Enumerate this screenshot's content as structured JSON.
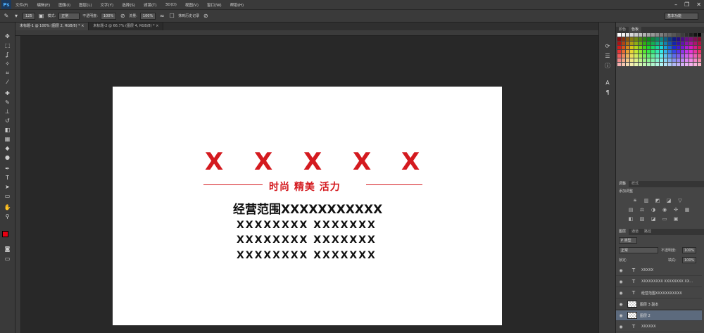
{
  "app": {
    "logo": "Ps"
  },
  "menu": [
    "文件(F)",
    "编辑(E)",
    "图像(I)",
    "图层(L)",
    "文字(Y)",
    "选择(S)",
    "滤镜(T)",
    "3D(D)",
    "视图(V)",
    "窗口(W)",
    "帮助(H)"
  ],
  "window_controls": {
    "minimize": "–",
    "restore": "❐",
    "close": "✕"
  },
  "options": {
    "brush_size": "125",
    "mode_label": "模式:",
    "mode_value": "正常",
    "opacity_label": "不透明度:",
    "opacity_value": "100%",
    "flow_label": "流量:",
    "flow_value": "100%",
    "history_label": "抹到历史记录",
    "workspace": "基本功能"
  },
  "tabs": [
    {
      "label": "未标题-1 @ 100% (图层 2, RGB/8) *  ×",
      "active": true
    },
    {
      "label": "未标题-2 @ 66.7% (图层 4, RGB/8) *  ×",
      "active": false
    }
  ],
  "canvas": {
    "x_marks": [
      "X",
      "X",
      "X",
      "X",
      "X"
    ],
    "tagline": "时尚 精美 活力",
    "scope": "经营范围XXXXXXXXXXX",
    "lines": [
      "XXXXXXXX XXXXXXX",
      "XXXXXXXX XXXXXXX",
      "XXXXXXXX XXXXXXX"
    ]
  },
  "colors": {
    "accent_red": "#d41a1f",
    "fg_color": "#e60012",
    "bg_color": "#ffffff"
  },
  "panels": {
    "swatch_tabs": [
      "颜色",
      "色板"
    ],
    "adjust_tabs": [
      "调整",
      "样式"
    ],
    "adjust_title": "添加调整",
    "layers_tabs": [
      "图层",
      "通道",
      "路径"
    ],
    "kind_label": "P 类型",
    "blend_mode": "正常",
    "opacity_label": "不透明度:",
    "opacity_value": "100%",
    "lock_label": "锁定:",
    "fill_label": "填充:",
    "fill_value": "100%",
    "layers": [
      {
        "name": "XXXXX",
        "type": "T",
        "selected": false
      },
      {
        "name": "XXXXXXXXX XXXXXXXX XX...",
        "type": "T",
        "selected": false
      },
      {
        "name": "经营范围XXXXXXXXXXX",
        "type": "T",
        "selected": false
      },
      {
        "name": "图层 3 副本",
        "type": "img",
        "selected": false
      },
      {
        "name": "图层 2",
        "type": "img",
        "selected": true
      },
      {
        "name": "XXXXXX",
        "type": "T",
        "selected": false
      }
    ]
  }
}
